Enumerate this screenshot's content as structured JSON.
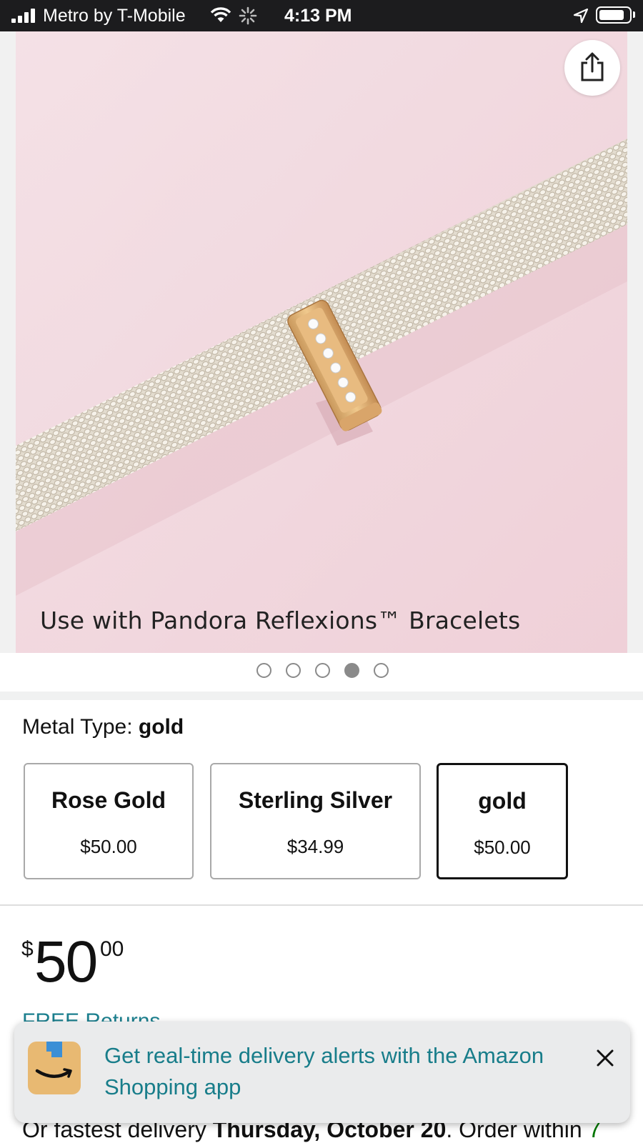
{
  "status_bar": {
    "carrier": "Metro by T-Mobile",
    "time": "4:13 PM",
    "battery_level": 0.85
  },
  "product_image": {
    "caption": "Use with Pandora Reflexions™ Bracelets",
    "carousel": {
      "total": 5,
      "active_index": 3
    }
  },
  "metal_type": {
    "label": "Metal Type: ",
    "selected": "gold",
    "options": [
      {
        "name": "Rose Gold",
        "price": "$50.00"
      },
      {
        "name": "Sterling Silver",
        "price": "$34.99"
      },
      {
        "name": "gold",
        "price": "$50.00"
      }
    ]
  },
  "price": {
    "symbol": "$",
    "whole": "50",
    "fraction": "00"
  },
  "free_returns": "FREE Returns",
  "delivery": {
    "prefix": "Or fastest delivery ",
    "date": "Thursday, October 20",
    "middle": ". Order within ",
    "countdown": "7"
  },
  "app_banner": {
    "text": "Get real-time delivery alerts with the Amazon Shopping app"
  },
  "colors": {
    "link_teal": "#1b7f8e",
    "selected_border": "#111111",
    "status_bar_bg": "#1c1c1e",
    "countdown_green": "#007600"
  }
}
